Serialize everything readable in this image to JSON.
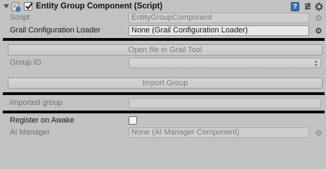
{
  "header": {
    "title": "Entity Group Component (Script)",
    "enabled": true,
    "icons": [
      "foldout-arrow-icon",
      "script-icon",
      "help-icon",
      "preset-icon",
      "settings-gear-icon"
    ]
  },
  "rows": {
    "script": {
      "label": "Script",
      "value": "EntityGroupComponent"
    },
    "loader": {
      "label": "Grail Configuration Loader",
      "value": "None (Grail Configuration Loader)"
    },
    "open_button": "Open file in Grail Tool",
    "group_id": {
      "label": "Group ID",
      "value": ""
    },
    "import_button": "Import Group",
    "imported": {
      "label": "Imported group",
      "value": ""
    },
    "register": {
      "label": "Register on Awake",
      "checked": false
    },
    "ai_manager": {
      "label": "AI Manager",
      "value": "None (AI Manager Component)"
    }
  },
  "colors": {
    "panel": "#c2c2c2",
    "separator": "#050505",
    "help": "#3b73b8"
  }
}
